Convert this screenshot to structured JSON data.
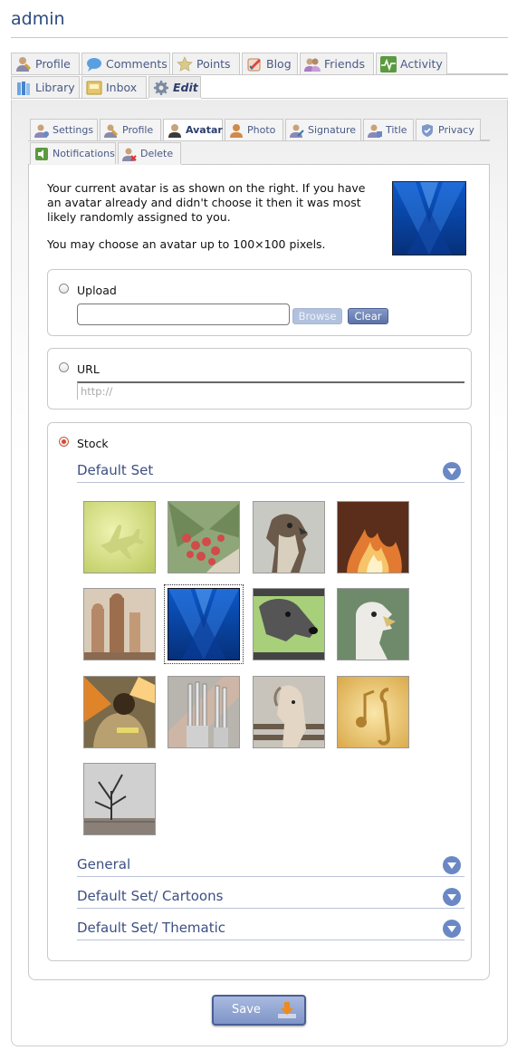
{
  "page": {
    "title": "admin"
  },
  "main_tabs": [
    {
      "label": "Profile",
      "icon": "profile-icon"
    },
    {
      "label": "Comments",
      "icon": "comments-icon"
    },
    {
      "label": "Points",
      "icon": "star-icon"
    },
    {
      "label": "Blog",
      "icon": "blog-icon"
    },
    {
      "label": "Friends",
      "icon": "friends-icon"
    },
    {
      "label": "Activity",
      "icon": "activity-icon"
    },
    {
      "label": "Library",
      "icon": "library-icon"
    },
    {
      "label": "Inbox",
      "icon": "inbox-icon"
    },
    {
      "label": "Edit",
      "icon": "gear-icon",
      "active": true
    }
  ],
  "sub_tabs": [
    {
      "label": "Settings",
      "icon": "settings-user-icon"
    },
    {
      "label": "Profile",
      "icon": "profile-edit-icon"
    },
    {
      "label": "Avatar",
      "icon": "avatar-icon",
      "active": true
    },
    {
      "label": "Photo",
      "icon": "photo-icon"
    },
    {
      "label": "Signature",
      "icon": "signature-icon"
    },
    {
      "label": "Title",
      "icon": "title-icon"
    },
    {
      "label": "Privacy",
      "icon": "shield-icon"
    },
    {
      "label": "Notifications",
      "icon": "notifications-icon"
    },
    {
      "label": "Delete",
      "icon": "delete-user-icon"
    }
  ],
  "intro": {
    "line1": "Your current avatar is as shown on the right. If you have an avatar already and didn't choose it then it was most likely randomly assigned to you.",
    "line2": "You may choose an avatar up to 100×100 pixels."
  },
  "upload": {
    "label": "Upload",
    "value": "",
    "browse": "Browse",
    "clear": "Clear"
  },
  "url": {
    "label": "URL",
    "placeholder": "http://"
  },
  "stock": {
    "label": "Stock",
    "sets": [
      {
        "name": "Default Set",
        "expanded": true
      },
      {
        "name": "General",
        "expanded": false
      },
      {
        "name": "Default Set/ Cartoons",
        "expanded": false
      },
      {
        "name": "Default Set/ Thematic",
        "expanded": false
      }
    ],
    "thumbnails": [
      {
        "name": "airplane-avatar"
      },
      {
        "name": "berries-avatar"
      },
      {
        "name": "hawk-avatar"
      },
      {
        "name": "fire-avatar"
      },
      {
        "name": "chess-avatar"
      },
      {
        "name": "blue-abstract-avatar",
        "selected": true
      },
      {
        "name": "dog-avatar"
      },
      {
        "name": "vulture-avatar"
      },
      {
        "name": "firefighter-avatar"
      },
      {
        "name": "forks-avatar"
      },
      {
        "name": "horse-avatar"
      },
      {
        "name": "music-avatar"
      },
      {
        "name": "tree-avatar"
      }
    ]
  },
  "save": {
    "label": "Save"
  },
  "colors": {
    "accent": "#6a88c4",
    "title": "#2d4a80",
    "radio_checked": "#e0452a"
  }
}
